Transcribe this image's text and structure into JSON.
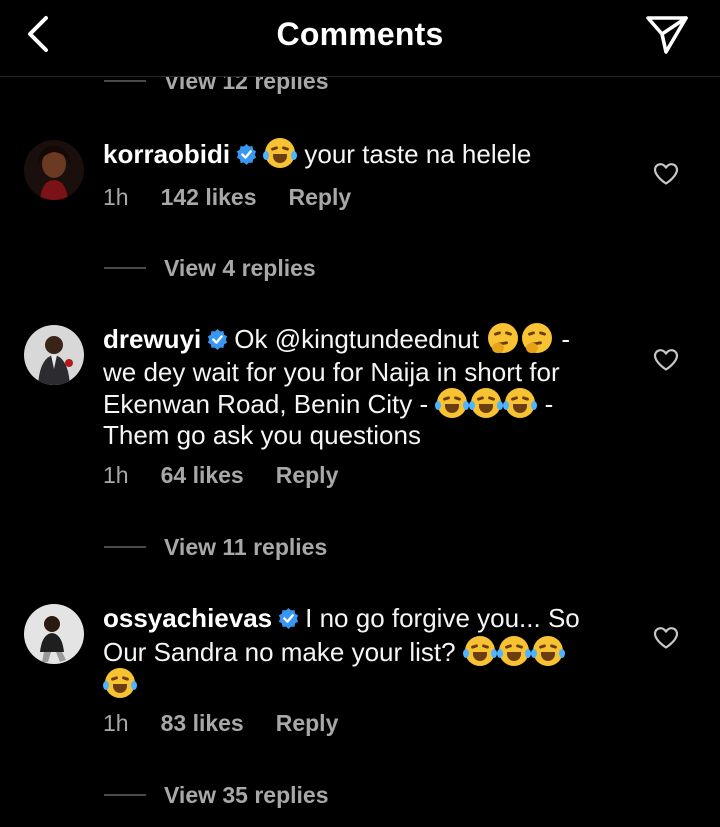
{
  "header": {
    "title": "Comments",
    "back_icon": "chevron-left-icon",
    "send_icon": "paper-plane-icon"
  },
  "top_view_replies": "View 12 replies",
  "comments": [
    {
      "username": "korraobidi",
      "text_after_emoji": "your taste na helele",
      "time": "1h",
      "likes": "142 likes",
      "reply": "Reply",
      "view_replies": "View 4 replies"
    },
    {
      "username": "drewuyi",
      "text_1": "Ok @kingtundeednut",
      "text_2": "-",
      "line_2": "we dey wait for you for Naija in short for",
      "line_3": "Ekenwan Road, Benin City -",
      "line_3_end": "-",
      "line_4": "Them go ask you questions",
      "time": "1h",
      "likes": "64 likes",
      "reply": "Reply",
      "view_replies": "View 11 replies"
    },
    {
      "username": "ossyachievas",
      "text_1": "I no go forgive you... So",
      "line_2": "Our Sandra no make your list?",
      "time": "1h",
      "likes": "83 likes",
      "reply": "Reply",
      "view_replies": "View 35 replies"
    }
  ],
  "colors": {
    "background": "#000000",
    "verified": "#3897f0",
    "secondary_text": "#a8a8a8"
  }
}
